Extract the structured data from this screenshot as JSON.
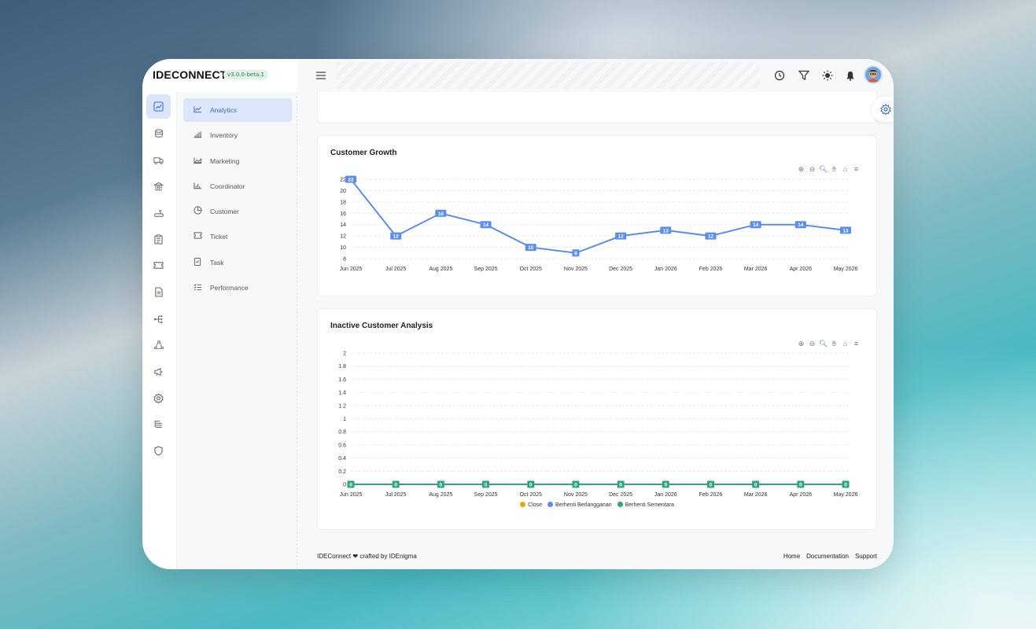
{
  "app": {
    "brand": "IDECONNECT",
    "version": "v3.0.0-beta.1"
  },
  "rail": {
    "icons": [
      "analytics-icon",
      "database-icon",
      "truck-icon",
      "bank-icon",
      "router-icon",
      "clipboard-icon",
      "ticket-icon",
      "document-icon",
      "hierarchy-icon",
      "cycle-icon",
      "megaphone-icon",
      "gear-icon",
      "list-tree-icon",
      "shield-icon"
    ]
  },
  "submenu": {
    "items": [
      {
        "label": "Analytics",
        "icon": "line-chart-icon",
        "active": true
      },
      {
        "label": "Inventory",
        "icon": "bar-chart-icon"
      },
      {
        "label": "Marketing",
        "icon": "area-chart-icon"
      },
      {
        "label": "Coordinator",
        "icon": "column-chart-icon"
      },
      {
        "label": "Customer",
        "icon": "pie-chart-icon"
      },
      {
        "label": "Ticket",
        "icon": "ticket-icon"
      },
      {
        "label": "Task",
        "icon": "clipboard-icon"
      },
      {
        "label": "Performance",
        "icon": "checklist-icon"
      }
    ]
  },
  "topbar": {
    "icons": [
      "history-icon",
      "filter-icon",
      "sun-icon",
      "bell-icon",
      "avatar"
    ]
  },
  "customer_growth": {
    "title": "Customer Growth"
  },
  "inactive": {
    "title": "Inactive Customer Analysis",
    "legend": [
      {
        "name": "Close",
        "color": "#f0a30a"
      },
      {
        "name": "Berhenti Berlangganan",
        "color": "#5b8def"
      },
      {
        "name": "Berhenti Sementara",
        "color": "#2fa57d"
      }
    ]
  },
  "footer": {
    "left_brand": "IDEConnect",
    "left_rest": "crafted by IDEnigma",
    "links": [
      "Home",
      "Documentation",
      "Support"
    ]
  },
  "chart_data": [
    {
      "type": "line",
      "title": "Customer Growth",
      "categories": [
        "Jun 2025",
        "Jul 2025",
        "Aug 2025",
        "Sep 2025",
        "Oct 2025",
        "Nov 2025",
        "Dec 2025",
        "Jan 2026",
        "Feb 2026",
        "Mar 2026",
        "Apr 2026",
        "May 2026"
      ],
      "series": [
        {
          "values": [
            22,
            12,
            16,
            14,
            10,
            9,
            12,
            13,
            12,
            14,
            14,
            13
          ],
          "color": "#5b8def"
        }
      ],
      "yticks": [
        8,
        10,
        12,
        14,
        16,
        18,
        20,
        22
      ],
      "ylim": [
        8,
        22
      ],
      "grid": true
    },
    {
      "type": "line",
      "title": "Inactive Customer Analysis",
      "categories": [
        "Jun 2025",
        "Jul 2025",
        "Aug 2025",
        "Sep 2025",
        "Oct 2025",
        "Nov 2025",
        "Dec 2025",
        "Jan 2026",
        "Feb 2026",
        "Mar 2026",
        "Apr 2026",
        "May 2026"
      ],
      "series": [
        {
          "name": "Close",
          "values": [
            0,
            0,
            0,
            0,
            0,
            0,
            0,
            0,
            0,
            0,
            0,
            0
          ],
          "color": "#f0a30a"
        },
        {
          "name": "Berhenti Berlangganan",
          "values": [
            0,
            0,
            0,
            0,
            0,
            0,
            0,
            0,
            0,
            0,
            0,
            0
          ],
          "color": "#5b8def"
        },
        {
          "name": "Berhenti Sementara",
          "values": [
            0,
            0,
            0,
            0,
            0,
            0,
            0,
            0,
            0,
            0,
            0,
            0
          ],
          "color": "#2fa57d"
        }
      ],
      "yticks": [
        "0",
        "0.2",
        "0.4",
        "0.6",
        "0.8",
        "1",
        "1.2",
        "1.4",
        "1.6",
        "1.8",
        "2"
      ],
      "ylim": [
        0,
        2
      ],
      "legend": "bottom",
      "grid": true
    }
  ]
}
